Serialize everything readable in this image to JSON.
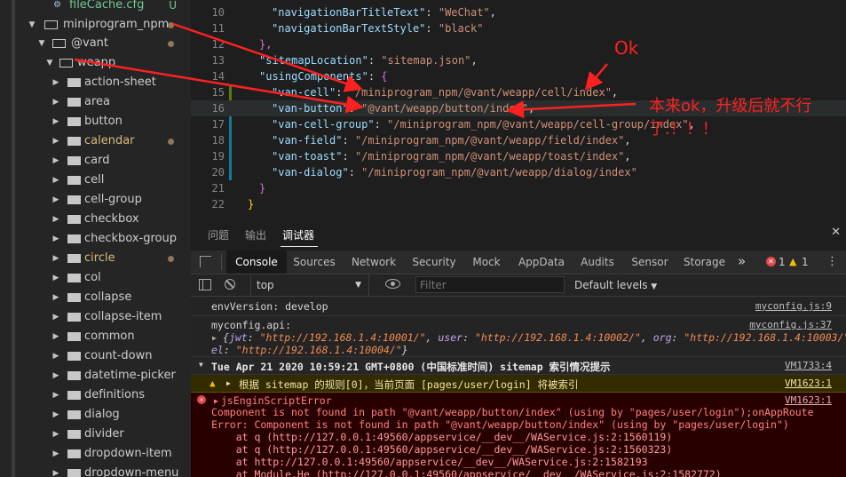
{
  "sidebar": {
    "top_file": {
      "label": "fileCache.cfg",
      "badge": "U"
    },
    "folders": [
      {
        "label": "miniprogram_npm",
        "modified": true
      },
      {
        "label": "@vant",
        "modified": true
      },
      {
        "label": "weapp",
        "modified": false
      }
    ],
    "items": [
      {
        "label": "action-sheet",
        "color": "#cccccc",
        "modified": false
      },
      {
        "label": "area",
        "color": "#cccccc",
        "modified": false
      },
      {
        "label": "button",
        "color": "#cccccc",
        "modified": false
      },
      {
        "label": "calendar",
        "color": "#d7ba7d",
        "modified": true
      },
      {
        "label": "card",
        "color": "#cccccc",
        "modified": false
      },
      {
        "label": "cell",
        "color": "#cccccc",
        "modified": false
      },
      {
        "label": "cell-group",
        "color": "#cccccc",
        "modified": false
      },
      {
        "label": "checkbox",
        "color": "#cccccc",
        "modified": false
      },
      {
        "label": "checkbox-group",
        "color": "#cccccc",
        "modified": false
      },
      {
        "label": "circle",
        "color": "#d7ba7d",
        "modified": true
      },
      {
        "label": "col",
        "color": "#cccccc",
        "modified": false
      },
      {
        "label": "collapse",
        "color": "#cccccc",
        "modified": false
      },
      {
        "label": "collapse-item",
        "color": "#cccccc",
        "modified": false
      },
      {
        "label": "common",
        "color": "#cccccc",
        "modified": false
      },
      {
        "label": "count-down",
        "color": "#cccccc",
        "modified": false
      },
      {
        "label": "datetime-picker",
        "color": "#cccccc",
        "modified": false
      },
      {
        "label": "definitions",
        "color": "#cccccc",
        "modified": false
      },
      {
        "label": "dialog",
        "color": "#cccccc",
        "modified": false
      },
      {
        "label": "divider",
        "color": "#cccccc",
        "modified": false
      },
      {
        "label": "dropdown-item",
        "color": "#cccccc",
        "modified": false
      },
      {
        "label": "dropdown-menu",
        "color": "#cccccc",
        "modified": false
      }
    ]
  },
  "editor": {
    "lines": [
      {
        "num": "10",
        "key": "\"navigationBarTitleText\"",
        "value": "\"WeChat\"",
        "tail": ","
      },
      {
        "num": "11",
        "key": "\"navigationBarTextStyle\"",
        "value": "\"black\"",
        "tail": ""
      },
      {
        "num": "12",
        "brace": "},"
      },
      {
        "num": "13",
        "key": "\"sitemapLocation\"",
        "value": "\"sitemap.json\"",
        "tail": ","
      },
      {
        "num": "14",
        "key": "\"usingComponents\"",
        "value": "",
        "tail": "{"
      },
      {
        "num": "15",
        "key": "\"van-cell\"",
        "value": "\"/miniprogram_npm/@vant/weapp/cell/index\"",
        "tail": ","
      },
      {
        "num": "16",
        "key": "\"van-button\"",
        "value": "\"@vant/weapp/button/index\"",
        "tail": ","
      },
      {
        "num": "17",
        "key": "\"van-cell-group\"",
        "value": "\"/miniprogram_npm/@vant/weapp/cell-group/index\"",
        "tail": ","
      },
      {
        "num": "18",
        "key": "\"van-field\"",
        "value": "\"/miniprogram_npm/@vant/weapp/field/index\"",
        "tail": ","
      },
      {
        "num": "19",
        "key": "\"van-toast\"",
        "value": "\"/miniprogram_npm/@vant/weapp/toast/index\"",
        "tail": ","
      },
      {
        "num": "20",
        "key": "\"van-dialog\"",
        "value": "\"/miniprogram_npm/@vant/weapp/dialog/index\"",
        "tail": ""
      },
      {
        "num": "21",
        "brace": "}"
      },
      {
        "num": "22",
        "brace": "}"
      }
    ]
  },
  "panel_tabs": [
    "问题",
    "输出",
    "调试器"
  ],
  "devtools": {
    "tabs": [
      "Console",
      "Sources",
      "Network",
      "Security",
      "Mock",
      "AppData",
      "Audits",
      "Sensor",
      "Storage"
    ],
    "more": "»",
    "error_count": "1",
    "warning_count": "1",
    "context": "top",
    "filter_placeholder": "Filter",
    "levels": "Default levels"
  },
  "console": {
    "env": {
      "text": "envVersion: develop",
      "source": "myconfig.js:9"
    },
    "api": {
      "text": "myconfig.api:",
      "source": "myconfig.js:37",
      "obj_line1_parts": [
        "{",
        "jwt",
        ": ",
        "\"http://192.168.1.4:10001/\"",
        ", ",
        "user",
        ": ",
        "\"http://192.168.1.4:10002/\"",
        ", ",
        "org",
        ": ",
        "\"http://192.168.1.4:10003/\"",
        ", r"
      ],
      "obj_line2_parts": [
        "el",
        ": ",
        "\"http://192.168.1.4:10004/\"",
        "}"
      ]
    },
    "group": {
      "text": "Tue Apr 21 2020 10:59:21 GMT+0800 (中国标准时间) sitemap 索引情况提示",
      "source": "VM1733:4"
    },
    "warning": {
      "text": "根据 sitemap 的规则[0]，当前页面 [pages/user/login] 将被索引",
      "source": "VM1623:1"
    },
    "error": {
      "title": "jsEnginScriptError",
      "source": "VM1623:1",
      "lines": [
        "Component is not found in path \"@vant/weapp/button/index\" (using by \"pages/user/login\");onAppRoute",
        "Error: Component is not found in path \"@vant/weapp/button/index\" (using by \"pages/user/login\")",
        "    at q (http://127.0.0.1:49560/appservice/__dev__/WAService.js:2:1560119)",
        "    at q (http://127.0.0.1:49560/appservice/__dev__/WAService.js:2:1560323)",
        "    at http://127.0.0.1:49560/appservice/__dev__/WAService.js:2:1582193",
        "    at Module.He (http://127.0.0.1:49560/appservice/__dev__/WAService.js:2:1582772)"
      ]
    }
  },
  "annotations": {
    "ok": "Ok",
    "note_line1": "本来ok，升级后就不行",
    "note_line2": "了.！！！",
    "color": "#ff2020"
  }
}
